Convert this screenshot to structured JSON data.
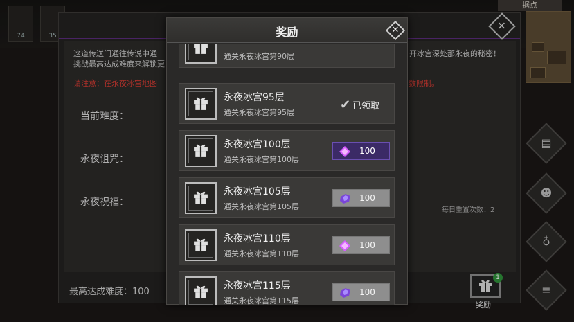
{
  "background": {
    "portraits": [
      {
        "count": "74"
      },
      {
        "count": "35"
      }
    ],
    "stronghold_label": "据点",
    "description_line1": "这道传送门通往传说中通",
    "description_line1_tail": "开冰宫深处那永夜的秘密！",
    "description_line2": "挑战最高达成难度来解锁更",
    "warning": "请注意：在永夜冰宫地图",
    "warning_tail": "数限制。",
    "current_difficulty_label": "当前难度：",
    "curse_label": "永夜诅咒：",
    "blessing_label": "永夜祝福：",
    "daily_reset": "每日重置次数：2",
    "best_difficulty": "最高达成难度：100",
    "reward_button_label": "奖励",
    "reward_badge": "1"
  },
  "dialog": {
    "title": "奖励",
    "items": [
      {
        "name": "",
        "subtitle": "通关永夜冰宫第90层",
        "status": "partial"
      },
      {
        "name": "永夜冰宫95层",
        "subtitle": "通关永夜冰宫第95层",
        "status": "claimed",
        "claimed_label": "已领取"
      },
      {
        "name": "永夜冰宫100层",
        "subtitle": "通关永夜冰宫第100层",
        "status": "claimable",
        "amount": "100"
      },
      {
        "name": "永夜冰宫105层",
        "subtitle": "通关永夜冰宫第105层",
        "status": "locked",
        "amount": "100"
      },
      {
        "name": "永夜冰宫110层",
        "subtitle": "通关永夜冰宫第110层",
        "status": "locked",
        "amount": "100"
      },
      {
        "name": "永夜冰宫115层",
        "subtitle": "通关永夜冰宫第115层",
        "status": "locked",
        "amount": "100"
      }
    ]
  },
  "colors": {
    "accent_purple": "#6a4fb0",
    "warning_red": "#d23b33",
    "badge_green": "#2f8f3a"
  }
}
